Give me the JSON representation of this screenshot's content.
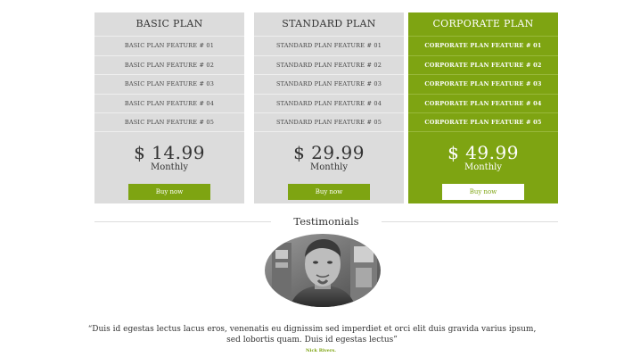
{
  "plans": [
    {
      "title": "BASIC PLAN",
      "features": [
        "BASIC PLAN FEATURE # 01",
        "BASIC PLAN FEATURE # 02",
        "BASIC PLAN FEATURE # 03",
        "BASIC PLAN FEATURE # 04",
        "BASIC PLAN FEATURE # 05"
      ],
      "price": "$ 14.99",
      "period": "Monthly",
      "button": "Buy now"
    },
    {
      "title": "STANDARD PLAN",
      "features": [
        "STANDARD PLAN FEATURE # 01",
        "STANDARD PLAN FEATURE # 02",
        "STANDARD PLAN FEATURE # 03",
        "STANDARD PLAN FEATURE # 04",
        "STANDARD PLAN FEATURE # 05"
      ],
      "price": "$ 29.99",
      "period": "Monthly",
      "button": "Buy now"
    },
    {
      "title": "CORPORATE PLAN",
      "features": [
        "CORPORATE PLAN FEATURE # 01",
        "CORPORATE PLAN FEATURE # 02",
        "CORPORATE PLAN FEATURE # 03",
        "CORPORATE PLAN FEATURE # 04",
        "CORPORATE PLAN FEATURE # 05"
      ],
      "price": "$ 49.99",
      "period": "Monthly",
      "button": "Buy now"
    }
  ],
  "testimonials": {
    "heading": "Testimonials",
    "quote": "“Duis id egestas lectus lacus eros, venenatis eu dignissim sed imperdiet et orci elit duis gravida varius ipsum, sed lobortis quam. Duis id egestas lectus”",
    "author": "Nick Rivers."
  },
  "colors": {
    "accent": "#7ea412",
    "card": "#dcdcdc"
  }
}
